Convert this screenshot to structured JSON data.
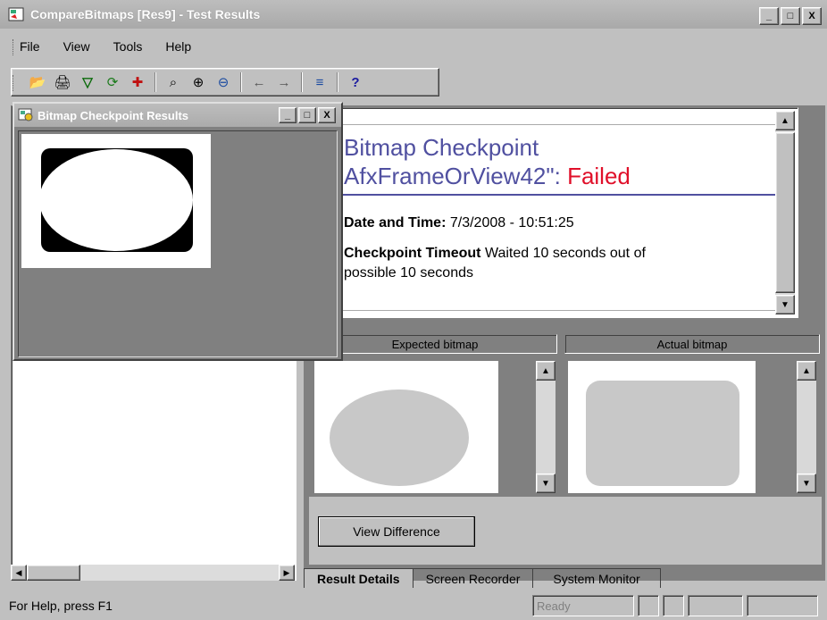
{
  "window": {
    "title": "CompareBitmaps [Res9] - Test Results",
    "min": "_",
    "max": "□",
    "close": "X"
  },
  "menu": [
    {
      "label": "File"
    },
    {
      "label": "View"
    },
    {
      "label": "Tools"
    },
    {
      "label": "Help"
    }
  ],
  "toolbar": {
    "icons": [
      "open-folder-icon",
      "print-icon",
      "filter-icon",
      "refresh-icon",
      "find-icon",
      "zoom-fit-icon",
      "zoom-in-icon",
      "zoom-out-icon",
      "back-arrow-icon",
      "forward-arrow-icon",
      "expand-icon",
      "help-icon"
    ],
    "glyphs": {
      "open": "📂",
      "print": "🖨",
      "filter": "▽",
      "refresh": "⟳",
      "find": "✚",
      "zfit": "⌕",
      "zin": "⊕",
      "zout": "⊖",
      "back": "←",
      "fwd": "→",
      "expand": "≡",
      "help": "?"
    }
  },
  "child_window": {
    "title": "Bitmap Checkpoint Results",
    "min": "_",
    "max": "□",
    "close": "X"
  },
  "details": {
    "title_line1": "Bitmap Checkpoint",
    "title_line2_prefix": "AfxFrameOrView42\":",
    "title_status": "Failed",
    "date_label": "Date and Time:",
    "date_value": "7/3/2008 - 10:51:25",
    "timeout_label": "Checkpoint Timeout",
    "timeout_value": "Waited 10 seconds out of",
    "timeout_value2": "possible 10 seconds"
  },
  "bitmaps": {
    "expected_label": "Expected bitmap",
    "actual_label": "Actual bitmap"
  },
  "view_difference": "View Difference",
  "tabs": [
    "Result Details",
    "Screen Recorder",
    "System Monitor"
  ],
  "status": {
    "help": "For Help, press F1",
    "ready": "Ready"
  },
  "colors": {
    "failed": "#e0102a",
    "title": "#5050a0"
  }
}
